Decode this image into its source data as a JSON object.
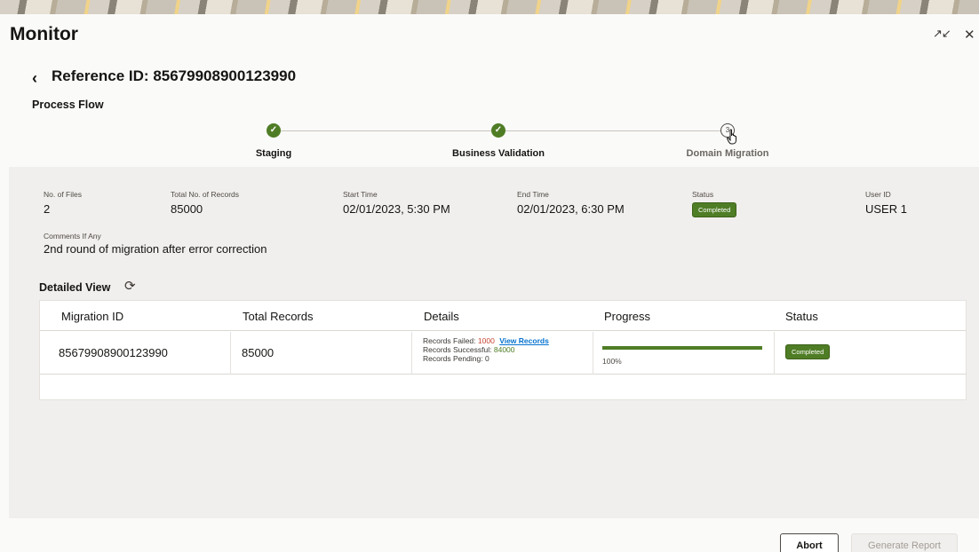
{
  "header": {
    "title": "Monitor"
  },
  "reference": {
    "title": "Reference ID: 85679908900123990"
  },
  "process_flow": {
    "label": "Process Flow",
    "steps": [
      {
        "label": "Staging",
        "state": "done"
      },
      {
        "label": "Business Validation",
        "state": "done"
      },
      {
        "label": "Domain Migration",
        "state": "current",
        "number": "3"
      }
    ]
  },
  "summary": {
    "files_label": "No. of Files",
    "files_value": "2",
    "records_label": "Total No. of Records",
    "records_value": "85000",
    "start_label": "Start Time",
    "start_value": "02/01/2023, 5:30 PM",
    "end_label": "End Time",
    "end_value": "02/01/2023, 6:30 PM",
    "status_label": "Status",
    "status_value": "Completed",
    "user_label": "User ID",
    "user_value": "USER 1",
    "comments_label": "Comments If Any",
    "comments_value": "2nd round of migration after error correction"
  },
  "detailed_view": {
    "label": "Detailed View",
    "columns": [
      "Migration ID",
      "Total Records",
      "Details",
      "Progress",
      "Status"
    ],
    "rows": [
      {
        "migration_id": "85679908900123990",
        "total_records": "85000",
        "failed_label": "Records Failed:",
        "failed_value": "1000",
        "view_records": "View Records",
        "success_label": "Records Successful:",
        "success_value": "84000",
        "pending_label": "Records Pending:",
        "pending_value": "0",
        "progress": 1.0,
        "progress_text": "100%",
        "status": "Completed"
      }
    ]
  },
  "actions": {
    "abort": "Abort",
    "generate_report": "Generate Report"
  },
  "colors": {
    "accent_green": "#4f7d26",
    "failed_red": "#c74634",
    "link_blue": "#0572ce"
  }
}
